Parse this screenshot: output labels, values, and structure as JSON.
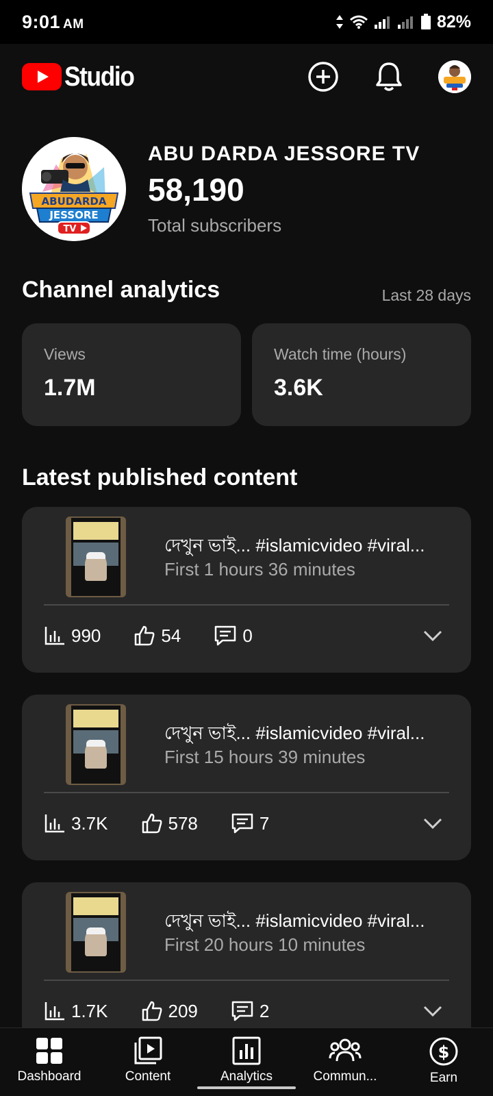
{
  "status": {
    "time": "9:01",
    "ampm": "AM",
    "battery": "82%"
  },
  "header": {
    "app_name": "Studio"
  },
  "channel": {
    "name": "ABU DARDA JESSORE TV",
    "subscribers": "58,190",
    "subscribers_label": "Total subscribers",
    "avatar_text": {
      "line1": "ABUDARDA",
      "line2": "JESSORE",
      "badge": "TV"
    }
  },
  "analytics": {
    "title": "Channel analytics",
    "range": "Last 28 days",
    "metrics": [
      {
        "label": "Views",
        "value": "1.7M"
      },
      {
        "label": "Watch time (hours)",
        "value": "3.6K"
      }
    ]
  },
  "latest": {
    "title": "Latest published content",
    "items": [
      {
        "title": "দেখুন ভাই... #islamicvideo #viral...",
        "age": "First 1 hours 36 minutes",
        "views": "990",
        "likes": "54",
        "comments": "0"
      },
      {
        "title": "দেখুন ভাই... #islamicvideo #viral...",
        "age": "First 15 hours 39 minutes",
        "views": "3.7K",
        "likes": "578",
        "comments": "7"
      },
      {
        "title": "দেখুন ভাই... #islamicvideo #viral...",
        "age": "First 20 hours 10 minutes",
        "views": "1.7K",
        "likes": "209",
        "comments": "2"
      }
    ]
  },
  "nav": {
    "items": [
      {
        "label": "Dashboard",
        "icon": "dashboard-icon"
      },
      {
        "label": "Content",
        "icon": "content-icon"
      },
      {
        "label": "Analytics",
        "icon": "analytics-icon"
      },
      {
        "label": "Commun...",
        "icon": "community-icon"
      },
      {
        "label": "Earn",
        "icon": "earn-icon"
      }
    ],
    "selected": "Analytics"
  },
  "colors": {
    "background": "#0f0f0f",
    "card": "#272727",
    "brand_red": "#ff0000",
    "secondary_text": "#aaaaaa"
  }
}
